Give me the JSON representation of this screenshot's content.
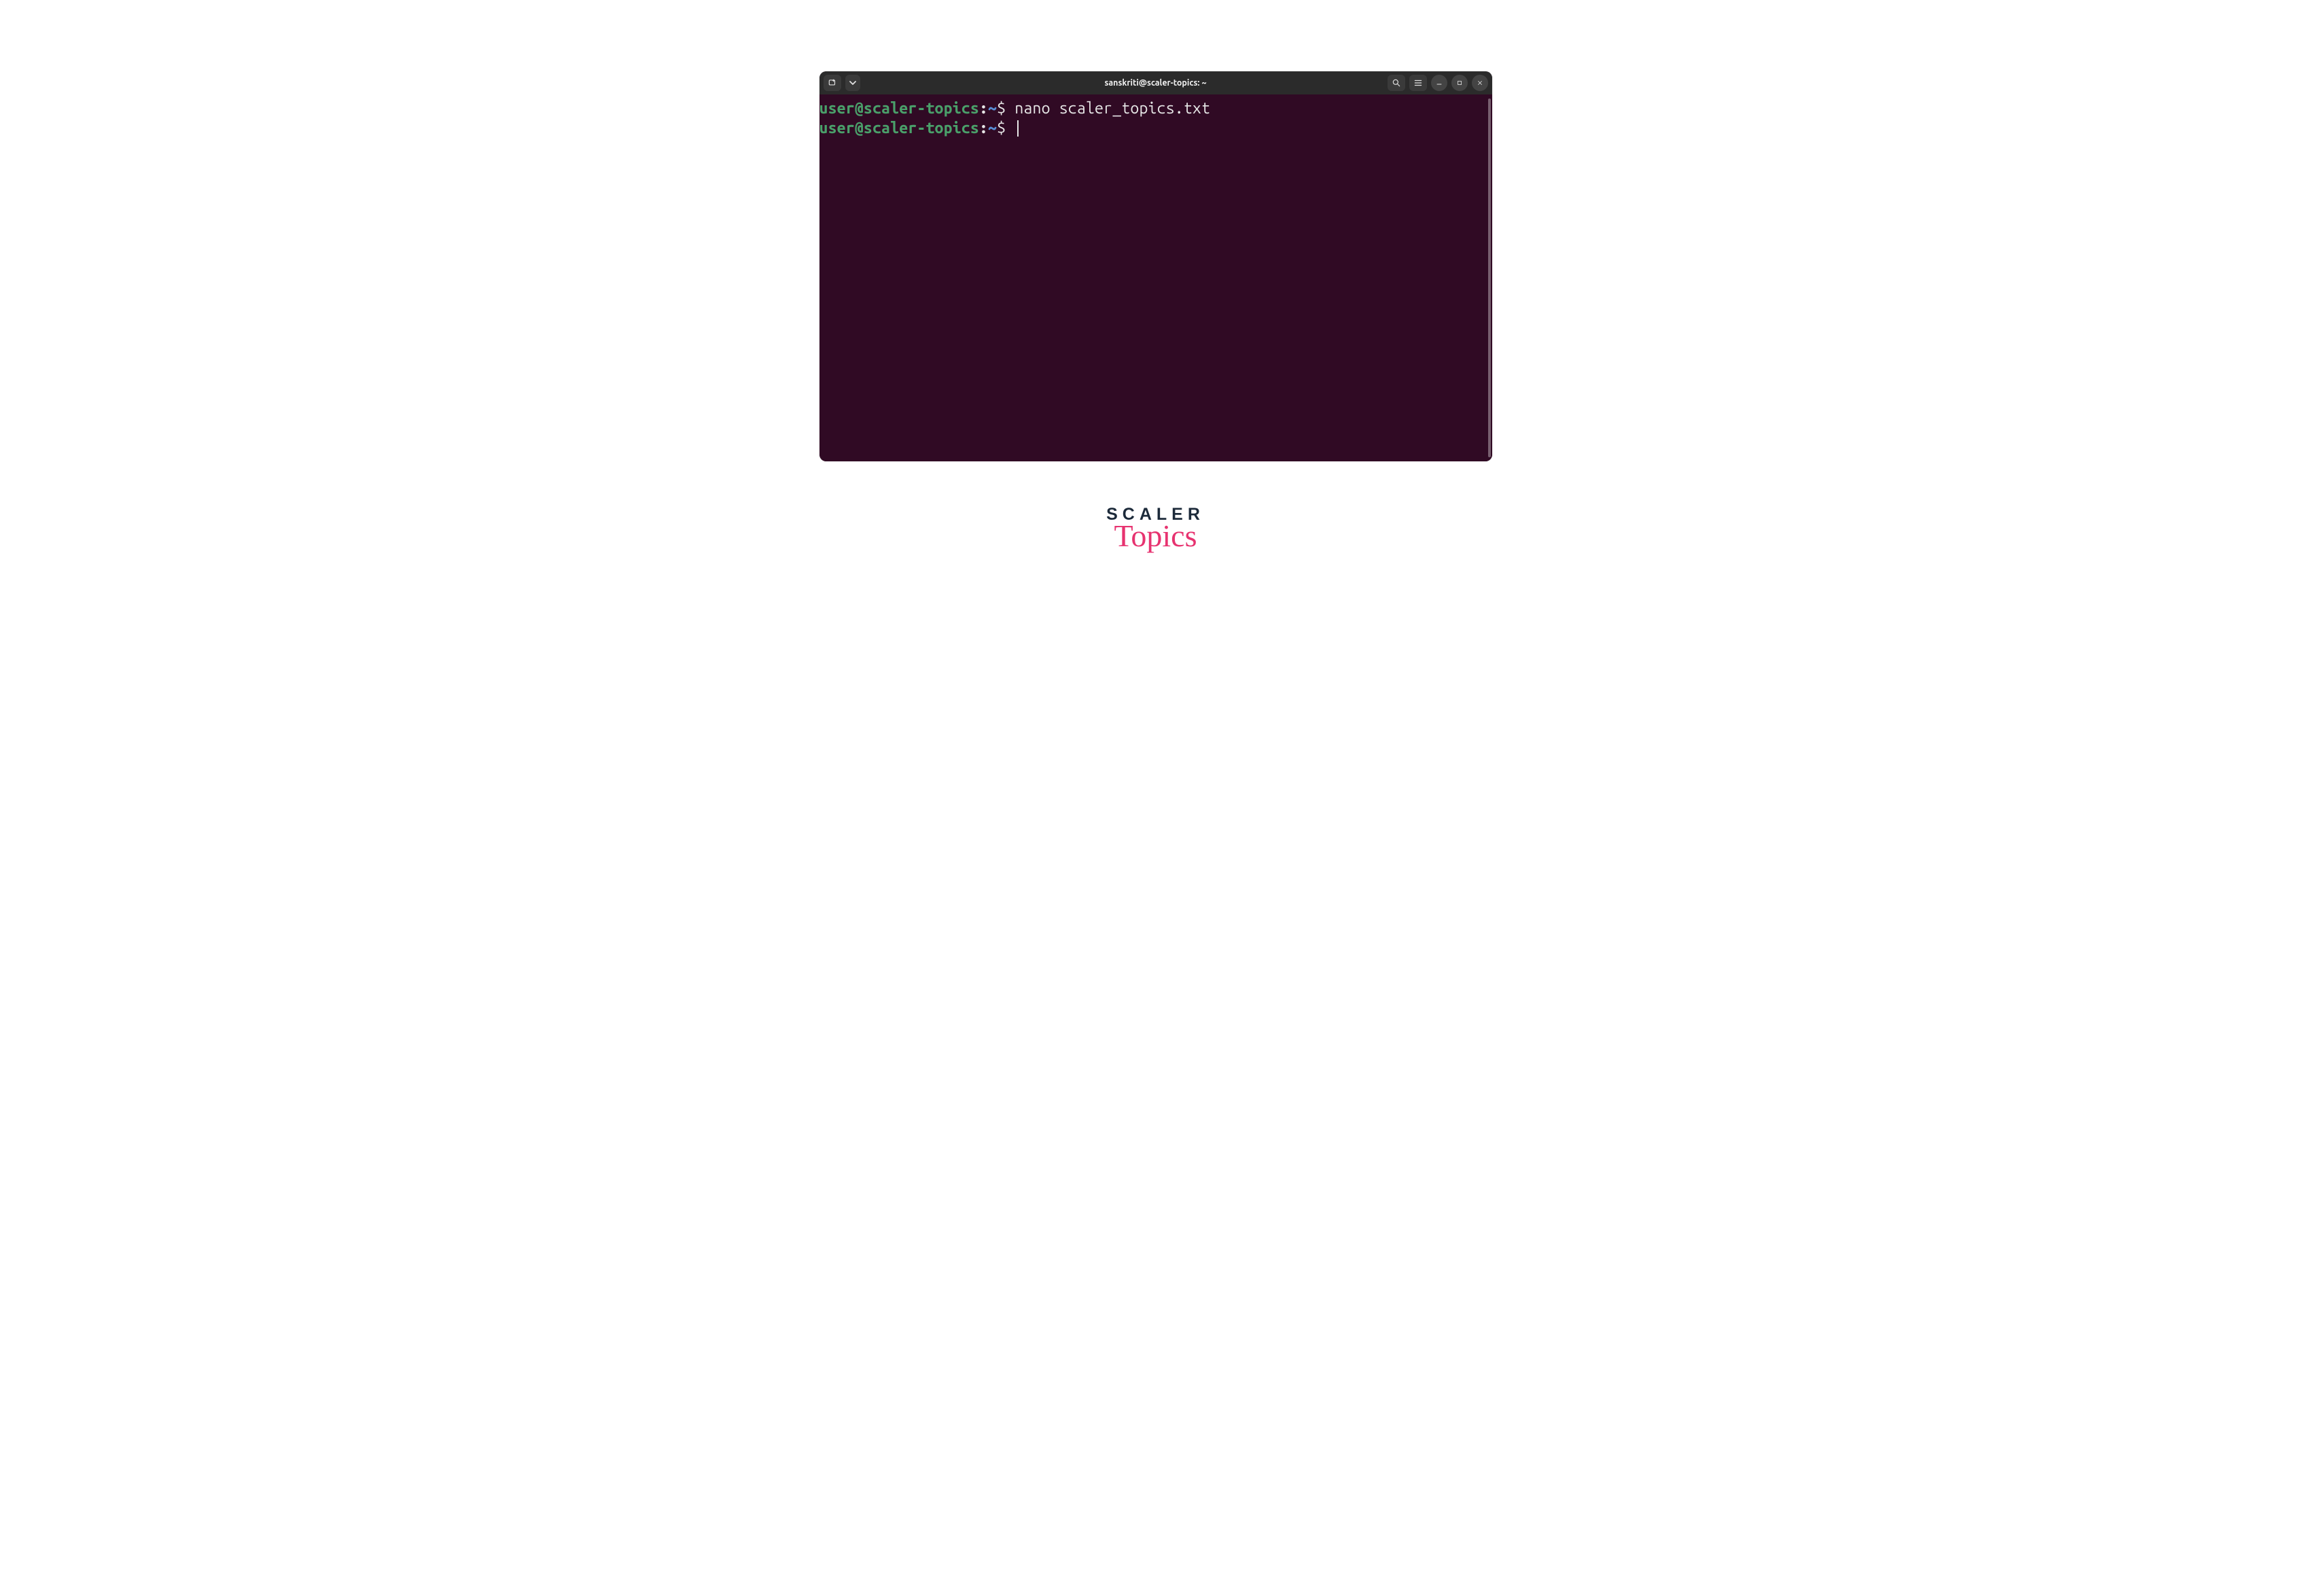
{
  "titlebar": {
    "title": "sanskriti@scaler-topics: ~"
  },
  "prompt": {
    "user_host": "user@scaler-topics",
    "separator": ":",
    "path": "~",
    "symbol": "$"
  },
  "lines": [
    {
      "command": "nano scaler_topics.txt"
    },
    {
      "command": ""
    }
  ],
  "branding": {
    "line1": "SCALER",
    "line2": "Topics"
  },
  "colors": {
    "terminal_bg": "#300a24",
    "titlebar_bg": "#2b2b2b",
    "prompt_user": "#4aa06a",
    "prompt_path": "#5a8fd6",
    "text": "#e6e6e6",
    "brand_dark": "#1c2a3a",
    "brand_pink": "#e73370"
  }
}
